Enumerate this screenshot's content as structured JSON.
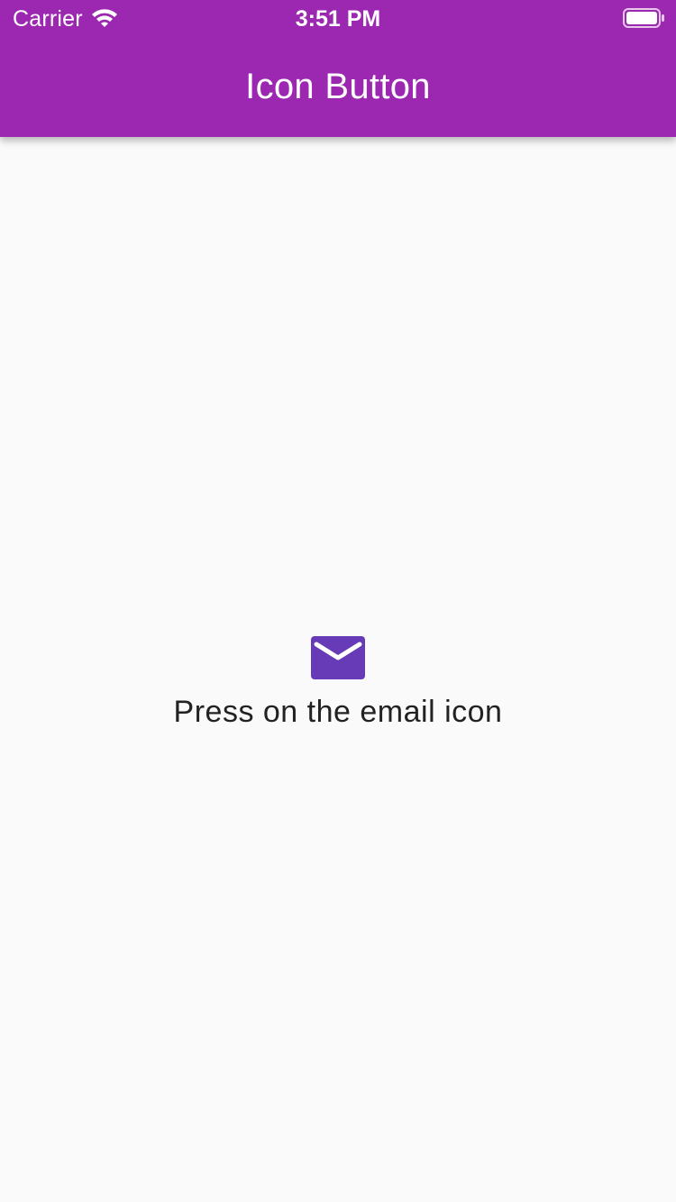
{
  "status_bar": {
    "carrier": "Carrier",
    "time": "3:51 PM",
    "wifi_icon": "wifi-icon",
    "battery_icon": "battery-icon"
  },
  "app_bar": {
    "title": "Icon Button",
    "background_color": "#9c27b0"
  },
  "main": {
    "email_button": {
      "icon": "email-icon",
      "color": "#673ab7"
    },
    "message": "Press on the email icon"
  }
}
